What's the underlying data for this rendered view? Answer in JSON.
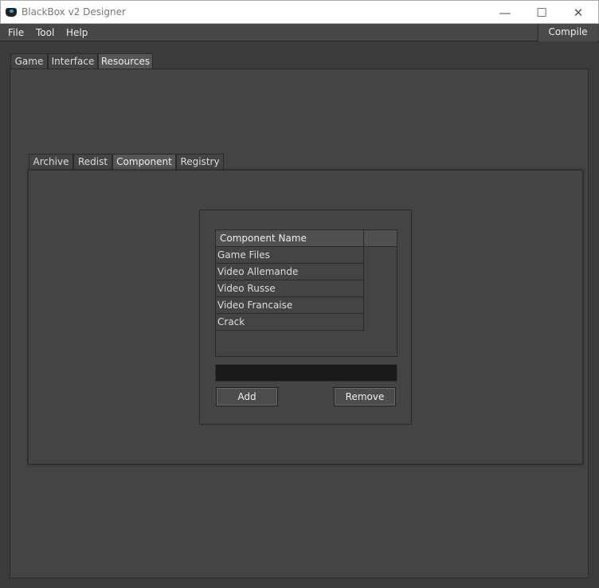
{
  "window": {
    "title": "BlackBox v2 Designer",
    "minimize": "—",
    "maximize": "☐",
    "close": "✕"
  },
  "menu": {
    "items": [
      "File",
      "Tool",
      "Help"
    ],
    "compile": "Compile"
  },
  "outer_tabs": [
    {
      "label": "Game"
    },
    {
      "label": "Interface"
    },
    {
      "label": "Resources",
      "selected": true
    }
  ],
  "inner_tabs": [
    {
      "label": "Archive"
    },
    {
      "label": "Redist"
    },
    {
      "label": "Component",
      "selected": true
    },
    {
      "label": "Registry"
    }
  ],
  "component": {
    "column_header": "Component Name",
    "rows": [
      "Game Files",
      "Video Allemande",
      "Video Russe",
      "Video Francaise",
      "Crack"
    ],
    "input_value": "",
    "add_label": "Add",
    "remove_label": "Remove"
  }
}
